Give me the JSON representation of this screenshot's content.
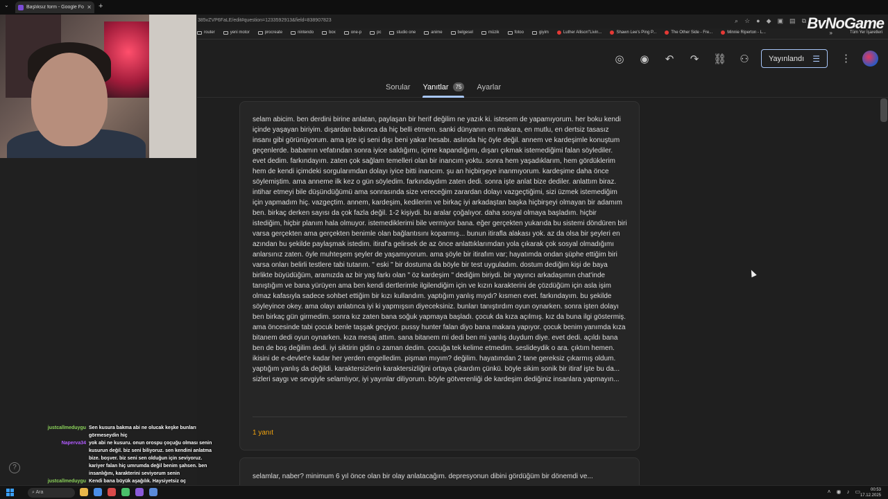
{
  "browser": {
    "tab_title": "Başlıksız form - Google Formlar",
    "url": "385vZVP6FaLE/edit#question=1233592913&field=838907823",
    "logo_text": "ByNoGame",
    "bookmarks": [
      "router",
      "yeni motor",
      "procreate",
      "nintendo",
      "box",
      "one-p",
      "pc",
      "studio one",
      "anime",
      "belgesel",
      "müzik",
      "fotoo",
      "giyim",
      "Luther Allison\"Livin...",
      "Shawn Lee's Ping P...",
      "The Other Side - Fre...",
      "Minnie Riperton - L..."
    ],
    "bookmarks_more": "»",
    "all_bookmarks": "Tüm Yer İşaretleri"
  },
  "forms": {
    "publish_label": "Yayınlandı",
    "tabs": {
      "questions": "Sorular",
      "responses": "Yanıtlar",
      "responses_count": "75",
      "settings": "Ayarlar"
    },
    "response_text": "selam abicim. ben derdini birine anlatan, paylaşan bir herif değilim ne yazık ki. istesem de yapamıyorum. her boku kendi içinde yaşayan biriyim. dışardan bakınca da hiç belli etmem. sanki dünyanın en makara, en mutlu, en dertsiz tasasız insanı gibi görünüyorum. ama işte içi seni dışı beni yakar hesabı. aslında hiç öyle değil. annem ve kardeşimle konuştum geçenlerde. babamın vefatından sonra iyice saldığımı, içime kapandığımı, dışarı çıkmak istemediğimi falan söylediler. evet dedim. farkındayım. zaten çok sağlam temelleri olan bir inancım yoktu. sonra hem yaşadıklarım, hem gördüklerim hem de kendi içimdeki sorgularımdan dolayı iyice bitti inancım. şu an hiçbirşeye inanmıyorum. kardeşime daha önce söylemiştim. ama anneme ilk kez o gün söyledim. farkındaydım zaten dedi. sonra işte anlat bize dediler. anlattım biraz. intihar etmeyi bile düşündüğümü ama sonrasında size vereceğim zarardan dolayı vazgeçtiğimi, sizi üzmek istemediğim için yapmadım hiç. vazgeçtim. annem, kardeşim, kedilerim ve birkaç iyi arkadaştan başka hiçbirşeyi olmayan bir adamım ben. birkaç derken sayısı da çok fazla değil. 1-2 kişiydi. bu aralar çoğalıyor. daha sosyal olmaya başladım. hiçbir istediğim, hiçbir planım hala olmuyor. istemediklerimi bile vermiyor bana. eğer gerçekten yukarıda bu sistemi döndüren biri varsa gerçekten ama gerçekten benimle olan bağlantısını koparmış... bunun itirafla alakası yok. az da olsa bir şeyleri en azından bu şekilde paylaşmak istedim. itiraf'a gelirsek de az önce anlattıklarımdan yola çıkarak çok sosyal olmadığımı anlarsınız zaten. öyle muhteşem şeyler de yaşamıyorum. ama şöyle bir itirafım var; hayatımda ondan şüphe ettiğim biri varsa onları belirli testlere tabi tutarım. \" eski \" bir dostuma da böyle bir test uyguladım. dostum dediğim kişi de baya birlikte büyüdüğüm, aramızda az bir yaş farkı olan \" öz kardeşim \" dediğim biriydi. bir yayıncı arkadaşımın chat'inde tanıştığım ve bana yürüyen ama ben kendi dertlerimle ilgilendiğim için ve kızın karakterini de çözdüğüm için asla işim olmaz kafasıyla sadece sohbet ettiğim bir kızı kullandım. yaptığım yanlış mıydı? kısmen evet. farkındayım. bu şekilde söyleyince okey. ama olayı anlatınca iyi ki yapmışsın diyeceksiniz. bunları tanıştırdım oyun oynarken. sonra işten dolayı ben birkaç gün girmedim. sonra kız zaten bana soğuk yapmaya başladı. çocuk da kıza açılmış. kız da buna ilgi göstermiş. ama öncesinde tabi çocuk benle taşşak geçiyor. pussy hunter falan diyo bana makara yapıyor. çocuk benim yanımda kıza bitanem dedi oyun oynarken. kıza mesaj attım. sana bitanem mi dedi ben mi yanlış duydum diye. evet dedi. açıldı bana ben de boş değilim dedi. iyi siktirin gidin o zaman dedim. çocuğa tek kelime etmedim. seslideydik o ara. çıktım hemen. ikisini de e-devlet'e kadar her yerden engelledim. pişman mıyım? değilim. hayatımdan 2 tane gereksiz çıkarmış oldum. yaptığım yanlış da değildi. karaktersizlerin karaktersizliğini ortaya çıkardım çünkü. böyle sikim sonik bir itiraf işte bu da... sizleri saygı ve sevgiyle selamlıyor, iyi yayınlar diliyorum. böyle götverenliği de kardeşim dediğiniz insanlara yapmayın...",
    "replies_label": "1 yanıt",
    "next_response_text": "selamlar, naber? minimum 6 yıl önce olan bir olay anlatacağım. depresyonun dibini gördüğüm bir dönemdi ve..."
  },
  "chat": [
    {
      "user": "justcallmeduygu",
      "color": "#8bd35a",
      "text": "Sen kusura bakma abi ne olucak keşke bunları görmeseydin hiç"
    },
    {
      "user": "Naperva34",
      "color": "#b15bff",
      "text": "yok abi ne kusuru. onun orospu çoçuğu olması senin kusurun değil. biz seni biliyoruz. sen kendini anlatma bize. boşver. biz seni sen olduğun için seviyoruz. kariyer falan hiç umrumda değil benim şahsen. ben insanlığını, karakterini seviyorum senin"
    },
    {
      "user": "justcallmeduygu",
      "color": "#8bd35a",
      "text": "Kendi bana büyük aşağılık. Haysiyetsiz oç"
    }
  ],
  "taskbar": {
    "search_label": "Ara",
    "time": "00:53",
    "date": "17.12.2025"
  }
}
